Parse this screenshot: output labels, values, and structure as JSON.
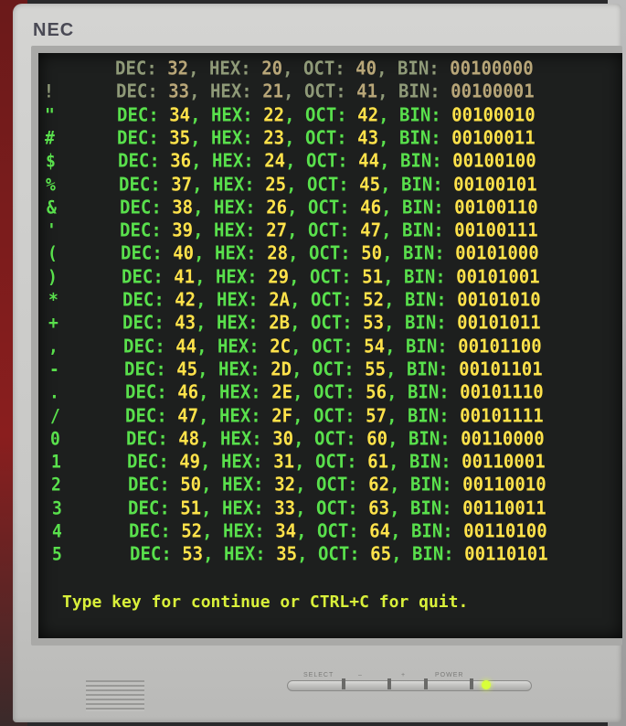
{
  "monitor": {
    "brand": "NEC",
    "button_select": "SELECT",
    "button_minus": "–",
    "button_plus": "+",
    "button_power": "POWER",
    "led_color": "#d8ff3a"
  },
  "colors": {
    "label": "#59e04c",
    "value": "#ffe24a",
    "prompt": "#d9f03a"
  },
  "rows": [
    {
      "ch": "",
      "dec": "32",
      "hex": "20",
      "oct": "40",
      "bin": "00100000"
    },
    {
      "ch": "!",
      "dec": "33",
      "hex": "21",
      "oct": "41",
      "bin": "00100001"
    },
    {
      "ch": "\"",
      "dec": "34",
      "hex": "22",
      "oct": "42",
      "bin": "00100010"
    },
    {
      "ch": "#",
      "dec": "35",
      "hex": "23",
      "oct": "43",
      "bin": "00100011"
    },
    {
      "ch": "$",
      "dec": "36",
      "hex": "24",
      "oct": "44",
      "bin": "00100100"
    },
    {
      "ch": "%",
      "dec": "37",
      "hex": "25",
      "oct": "45",
      "bin": "00100101"
    },
    {
      "ch": "&",
      "dec": "38",
      "hex": "26",
      "oct": "46",
      "bin": "00100110"
    },
    {
      "ch": "'",
      "dec": "39",
      "hex": "27",
      "oct": "47",
      "bin": "00100111"
    },
    {
      "ch": "(",
      "dec": "40",
      "hex": "28",
      "oct": "50",
      "bin": "00101000"
    },
    {
      "ch": ")",
      "dec": "41",
      "hex": "29",
      "oct": "51",
      "bin": "00101001"
    },
    {
      "ch": "*",
      "dec": "42",
      "hex": "2A",
      "oct": "52",
      "bin": "00101010"
    },
    {
      "ch": "+",
      "dec": "43",
      "hex": "2B",
      "oct": "53",
      "bin": "00101011"
    },
    {
      "ch": ",",
      "dec": "44",
      "hex": "2C",
      "oct": "54",
      "bin": "00101100"
    },
    {
      "ch": "-",
      "dec": "45",
      "hex": "2D",
      "oct": "55",
      "bin": "00101101"
    },
    {
      "ch": ".",
      "dec": "46",
      "hex": "2E",
      "oct": "56",
      "bin": "00101110"
    },
    {
      "ch": "/",
      "dec": "47",
      "hex": "2F",
      "oct": "57",
      "bin": "00101111"
    },
    {
      "ch": "0",
      "dec": "48",
      "hex": "30",
      "oct": "60",
      "bin": "00110000"
    },
    {
      "ch": "1",
      "dec": "49",
      "hex": "31",
      "oct": "61",
      "bin": "00110001"
    },
    {
      "ch": "2",
      "dec": "50",
      "hex": "32",
      "oct": "62",
      "bin": "00110010"
    },
    {
      "ch": "3",
      "dec": "51",
      "hex": "33",
      "oct": "63",
      "bin": "00110011"
    },
    {
      "ch": "4",
      "dec": "52",
      "hex": "34",
      "oct": "64",
      "bin": "00110100"
    },
    {
      "ch": "5",
      "dec": "53",
      "hex": "35",
      "oct": "65",
      "bin": "00110101"
    }
  ],
  "labels": {
    "dec": "DEC:",
    "hex": "HEX:",
    "oct": "OCT:",
    "bin": "BIN:"
  },
  "prompt": "Type key for continue or CTRL+C for quit."
}
